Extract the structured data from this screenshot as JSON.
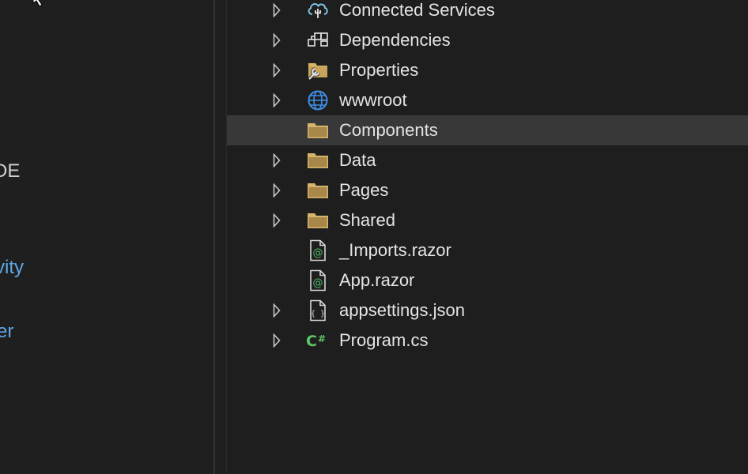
{
  "left_pane": {
    "heading_fragment": "DE",
    "link1_fragment": "vity",
    "link2_fragment": "er"
  },
  "colors": {
    "folder": "#d7b46a",
    "link": "#5fa8e8",
    "csharp": "#5fc46a",
    "razor": "#4fbf6a",
    "globe": "#3e8fe6"
  },
  "tree": {
    "items": [
      {
        "label": "Connected Services",
        "icon": "connected-services-icon",
        "expandable": true
      },
      {
        "label": "Dependencies",
        "icon": "dependencies-icon",
        "expandable": true
      },
      {
        "label": "Properties",
        "icon": "properties-icon",
        "expandable": true
      },
      {
        "label": "wwwroot",
        "icon": "globe-icon",
        "expandable": true
      },
      {
        "label": "Components",
        "icon": "folder-icon",
        "expandable": false,
        "selected": true
      },
      {
        "label": "Data",
        "icon": "folder-icon",
        "expandable": true
      },
      {
        "label": "Pages",
        "icon": "folder-icon",
        "expandable": true
      },
      {
        "label": "Shared",
        "icon": "folder-icon",
        "expandable": true
      },
      {
        "label": "_Imports.razor",
        "icon": "razor-file-icon",
        "expandable": false
      },
      {
        "label": "App.razor",
        "icon": "razor-file-icon",
        "expandable": false
      },
      {
        "label": "appsettings.json",
        "icon": "json-file-icon",
        "expandable": true
      },
      {
        "label": "Program.cs",
        "icon": "csharp-file-icon",
        "expandable": true
      }
    ]
  }
}
